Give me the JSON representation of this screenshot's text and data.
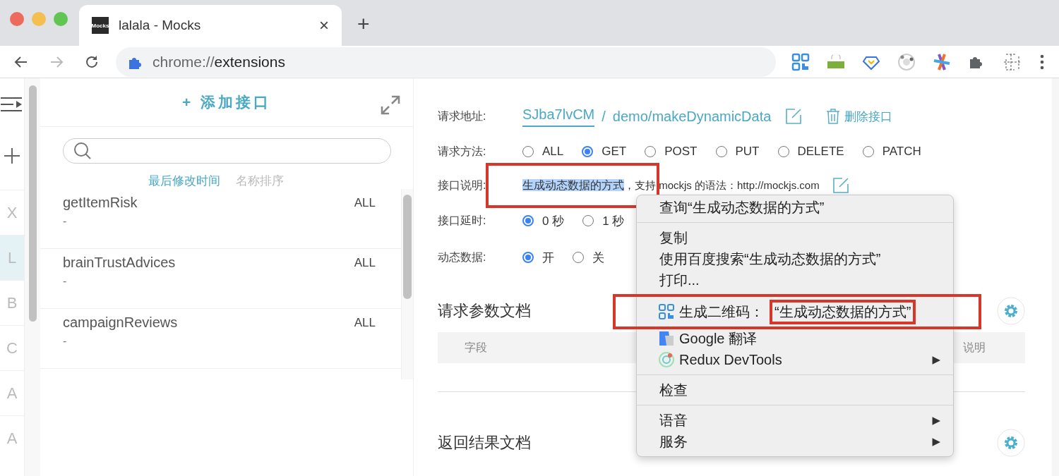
{
  "browser": {
    "tab": {
      "favicon": "Mocks",
      "title": "lalala - Mocks",
      "close": "×"
    },
    "new_tab": "+",
    "address": {
      "scheme": "chrome://",
      "path": "extensions"
    }
  },
  "side_rail": {
    "letters": [
      {
        "text": "X",
        "selected": false
      },
      {
        "text": "L",
        "selected": true
      },
      {
        "text": "B",
        "selected": false
      },
      {
        "text": "C",
        "selected": false
      },
      {
        "text": "A",
        "selected": false
      },
      {
        "text": "A",
        "selected": false
      }
    ]
  },
  "list_panel": {
    "add_label": "+ 添加接口",
    "sort_options": [
      {
        "label": "最后修改时间",
        "selected": true
      },
      {
        "label": "名称排序",
        "selected": false
      }
    ],
    "items": [
      {
        "name": "getItemRisk",
        "method": "ALL",
        "desc": "-"
      },
      {
        "name": "brainTrustAdvices",
        "method": "ALL",
        "desc": "-"
      },
      {
        "name": "campaignReviews",
        "method": "ALL",
        "desc": "-"
      }
    ]
  },
  "detail": {
    "url": {
      "label": "请求地址:",
      "project": "SJba7lvCM",
      "separator": "/",
      "path": "demo/makeDynamicData",
      "delete": "删除接口"
    },
    "method": {
      "label": "请求方法:",
      "options": [
        {
          "label": "ALL",
          "selected": false
        },
        {
          "label": "GET",
          "selected": true
        },
        {
          "label": "POST",
          "selected": false
        },
        {
          "label": "PUT",
          "selected": false
        },
        {
          "label": "DELETE",
          "selected": false
        },
        {
          "label": "PATCH",
          "selected": false
        }
      ]
    },
    "description": {
      "label": "接口说明:",
      "selected_text": "生成动态数据的方式",
      "annotated": true,
      "rest": "，支持 mockjs 的语法：http://mockjs.com"
    },
    "delay": {
      "label": "接口延时:",
      "options": [
        {
          "label": "0 秒",
          "selected": true
        },
        {
          "label": "1 秒",
          "selected": false
        }
      ]
    },
    "dynamic": {
      "label": "动态数据:",
      "options": [
        {
          "label": "开",
          "selected": true
        },
        {
          "label": "关",
          "selected": false
        }
      ]
    },
    "sections": [
      {
        "title": "请求参数文档",
        "columns": [
          "字段",
          "说明"
        ]
      },
      {
        "title": "返回结果文档"
      }
    ]
  },
  "context_menu": {
    "groups": [
      [
        {
          "label": "查询“生成动态数据的方式”",
          "kind": "plain",
          "submenu": false
        }
      ],
      [
        {
          "label": "复制",
          "kind": "plain",
          "submenu": false
        },
        {
          "label": "使用百度搜索“生成动态数据的方式”",
          "kind": "plain",
          "submenu": false
        },
        {
          "label": "打印...",
          "kind": "plain",
          "submenu": false
        }
      ],
      [
        {
          "label": "生成二维码：",
          "quoted": "“生成动态数据的方式”",
          "kind": "qr",
          "annotated": true,
          "submenu": false
        },
        {
          "label": "Google 翻译",
          "kind": "translate",
          "submenu": false
        },
        {
          "label": "Redux DevTools",
          "kind": "redux",
          "submenu": true
        }
      ],
      [
        {
          "label": "检查",
          "kind": "plain",
          "submenu": false
        }
      ],
      [
        {
          "label": "语音",
          "kind": "plain",
          "submenu": true
        },
        {
          "label": "服务",
          "kind": "plain",
          "submenu": true
        }
      ]
    ],
    "arrow": "▶"
  }
}
